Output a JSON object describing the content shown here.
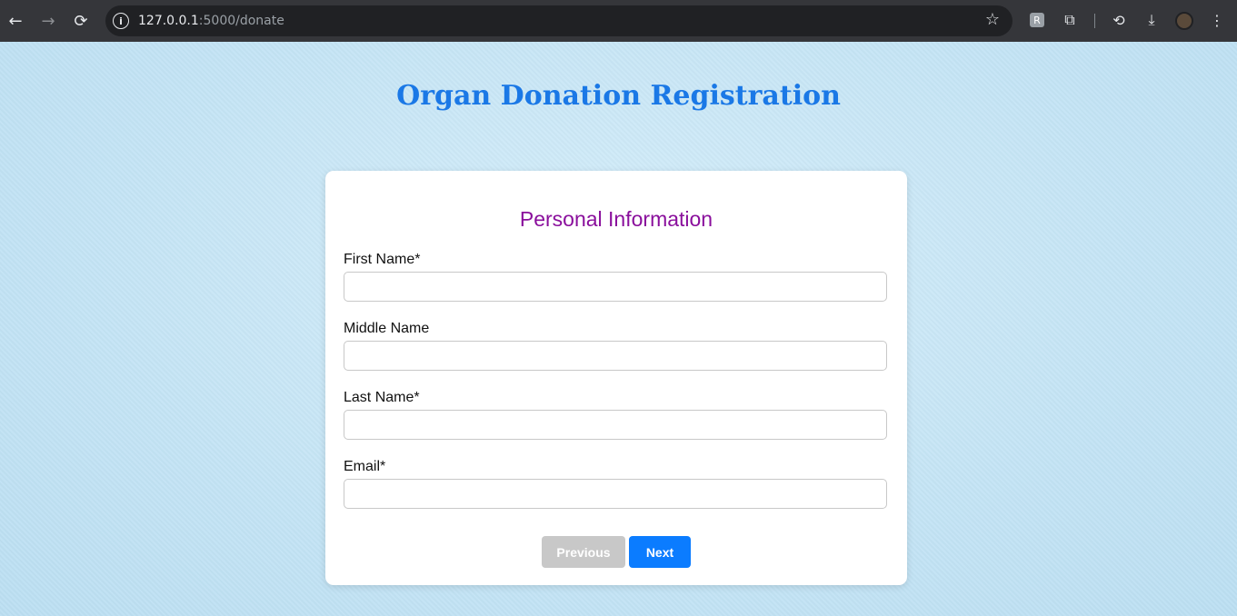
{
  "browser": {
    "url_host": "127.0.0.1",
    "url_path": ":5000/donate",
    "icons": [
      "back-icon",
      "forward-icon",
      "reload-icon",
      "info-icon",
      "star-icon",
      "extension-icon",
      "puzzle-icon",
      "sync-icon",
      "download-icon",
      "profile-avatar",
      "more-icon"
    ]
  },
  "page": {
    "heading": "Organ Donation Registration",
    "section_title": "Personal Information",
    "fields": [
      {
        "label": "First Name*",
        "value": "",
        "placeholder": ""
      },
      {
        "label": "Middle Name",
        "value": "",
        "placeholder": ""
      },
      {
        "label": "Last Name*",
        "value": "",
        "placeholder": ""
      },
      {
        "label": "Email*",
        "value": "",
        "placeholder": ""
      }
    ],
    "buttons": {
      "previous": "Previous",
      "next": "Next"
    }
  },
  "colors": {
    "heading": "#1a78e6",
    "section_title": "#8a0f9c",
    "next_button": "#0b7cff",
    "previous_button_disabled": "#c8c8c8"
  }
}
